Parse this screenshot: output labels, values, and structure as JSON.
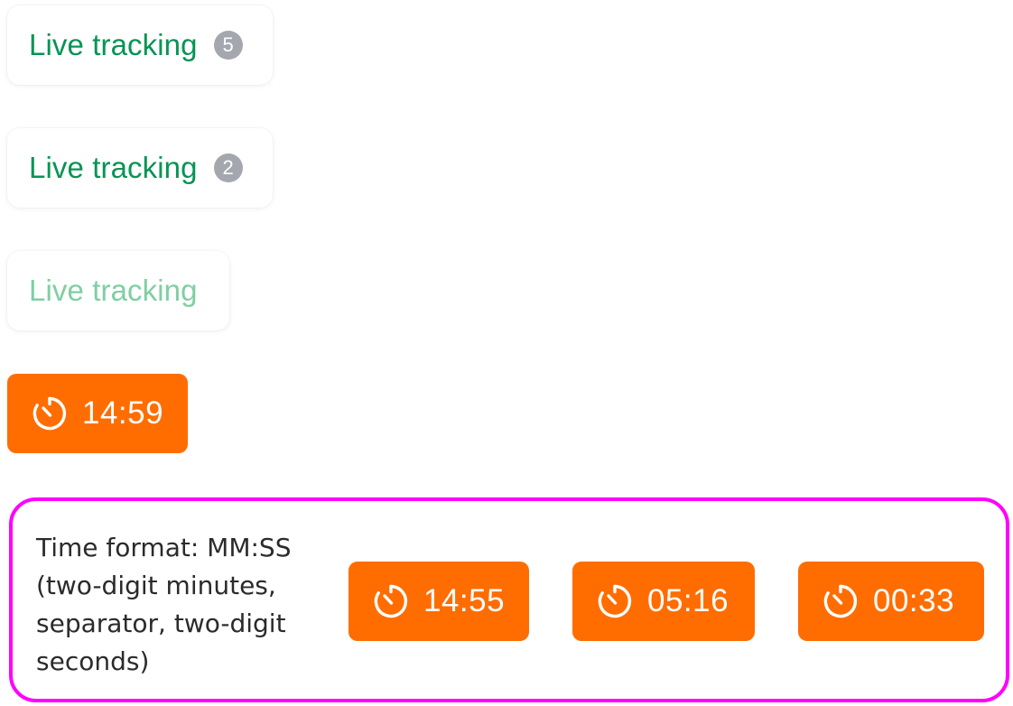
{
  "live_tracking": [
    {
      "label": "Live tracking",
      "count": "5",
      "state": "default"
    },
    {
      "label": "Live tracking",
      "count": "2",
      "state": "default"
    },
    {
      "label": "Live tracking",
      "count": null,
      "state": "disabled"
    }
  ],
  "timer": {
    "icon": "stopwatch-icon",
    "value": "14:59"
  },
  "format_demo": {
    "caption": "Time format: MM:SS (two-digit minutes, separator, two-digit seconds)",
    "examples": [
      "14:55",
      "05:16",
      "00:33"
    ]
  },
  "colors": {
    "live_green": "#079455",
    "live_green_disabled": "#7fcfa3",
    "badge_gray": "#a4a7ae",
    "timer_orange": "#ff6d00",
    "frame_magenta": "#ff00ff"
  }
}
